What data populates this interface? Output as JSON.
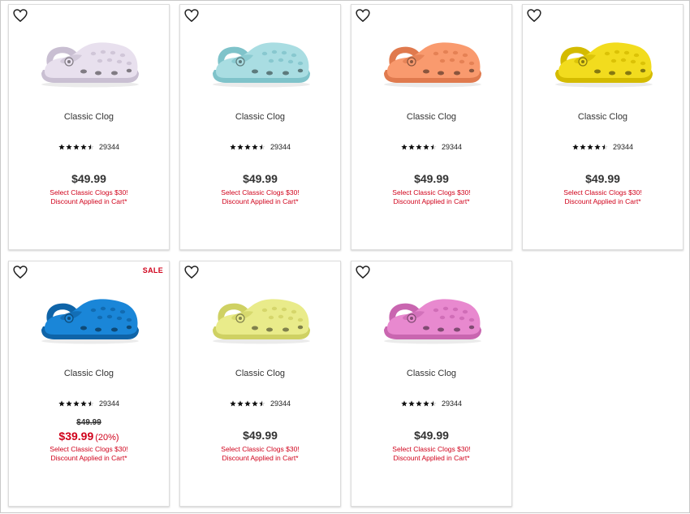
{
  "products": [
    {
      "name": "Classic Clog",
      "rating": 4.5,
      "review_count": "29344",
      "price": "$49.99",
      "promo_line1": "Select Classic Clogs $30!",
      "promo_line2": "Discount Applied in Cart*",
      "color": "#e8e0ee",
      "shade": "#c9bfd2"
    },
    {
      "name": "Classic Clog",
      "rating": 4.5,
      "review_count": "29344",
      "price": "$49.99",
      "promo_line1": "Select Classic Clogs $30!",
      "promo_line2": "Discount Applied in Cart*",
      "color": "#a9dde2",
      "shade": "#7fc3ca"
    },
    {
      "name": "Classic Clog",
      "rating": 4.5,
      "review_count": "29344",
      "price": "$49.99",
      "promo_line1": "Select Classic Clogs $30!",
      "promo_line2": "Discount Applied in Cart*",
      "color": "#f99a6e",
      "shade": "#e07a4e"
    },
    {
      "name": "Classic Clog",
      "rating": 4.5,
      "review_count": "29344",
      "price": "$49.99",
      "promo_line1": "Select Classic Clogs $30!",
      "promo_line2": "Discount Applied in Cart*",
      "color": "#f2dc1e",
      "shade": "#d4bb00"
    },
    {
      "name": "Classic Clog",
      "rating": 4.5,
      "review_count": "29344",
      "badge": "SALE",
      "original_price": "$49.99",
      "sale_price": "$39.99",
      "discount": "(20%)",
      "promo_line1": "Select Classic Clogs $30!",
      "promo_line2": "Discount Applied in Cart*",
      "color": "#1a86d8",
      "shade": "#0f64a8"
    },
    {
      "name": "Classic Clog",
      "rating": 4.5,
      "review_count": "29344",
      "price": "$49.99",
      "promo_line1": "Select Classic Clogs $30!",
      "promo_line2": "Discount Applied in Cart*",
      "color": "#e9eb8a",
      "shade": "#cfd163"
    },
    {
      "name": "Classic Clog",
      "rating": 4.5,
      "review_count": "29344",
      "price": "$49.99",
      "promo_line1": "Select Classic Clogs $30!",
      "promo_line2": "Discount Applied in Cart*",
      "color": "#e889cf",
      "shade": "#c966b0"
    }
  ]
}
